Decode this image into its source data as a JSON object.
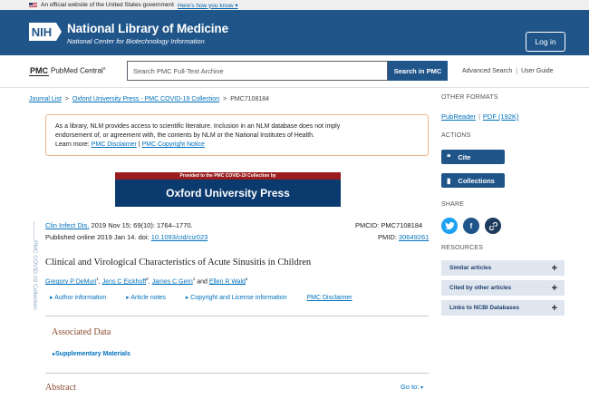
{
  "gov_banner": {
    "text": "An official website of the United States government",
    "link": "Here's how you know"
  },
  "header": {
    "logo": "NIH",
    "title": "National Library of Medicine",
    "subtitle": "National Center for Biotechnology Information",
    "login_label": "Log in"
  },
  "pmc": {
    "logo_mark": "PMC",
    "logo_name": "PubMed Central",
    "logo_sup": "®",
    "search_placeholder": "Search PMC Full-Text Archive",
    "search_button": "Search in PMC",
    "advanced_search": "Advanced Search",
    "user_guide": "User Guide"
  },
  "breadcrumb": {
    "items": [
      "Journal List",
      "Oxford University Press - PMC COVID-19 Collection",
      "PMC7108184"
    ]
  },
  "notice": {
    "line1": "As a library, NLM provides access to scientific literature. Inclusion in an NLM database does not imply",
    "line2": "endorsement of, or agreement with, the contents by NLM or the National Institutes of Health.",
    "learn_more": "Learn more:",
    "disclaimer": "PMC Disclaimer",
    "copyright": "PMC Copyright Notice"
  },
  "banner": {
    "top": "Provided to the PMC COVID-19 Collection by",
    "main": "Oxford University Press"
  },
  "article": {
    "side_label": "PMC COVID-19 Collection",
    "journal": "Clin Infect Dis.",
    "citation": " 2019 Nov 15; 69(10): 1764–1770.",
    "published": "Published online 2019 Jan 14. doi: ",
    "doi": "10.1093/cid/ciz023",
    "pmcid": "PMCID: PMC7108184",
    "pmid_label": "PMID: ",
    "pmid": "30649261",
    "title": "Clinical and Virological Characteristics of Acute Sinusitis in Children",
    "authors": [
      {
        "name": "Gregory P DeMuri",
        "sup": "1"
      },
      {
        "name": "Jens C Eickhoff",
        "sup": "2"
      },
      {
        "name": "James C Gern",
        "sup": "1"
      },
      {
        "name": "Ellen R Wald",
        "sup": "1"
      }
    ],
    "and": " and ",
    "links": [
      "Author information",
      "Article notes",
      "Copyright and License information"
    ],
    "disclaimer": "PMC Disclaimer",
    "associated_data": "Associated Data",
    "supplementary": "Supplementary Materials",
    "abstract": "Abstract",
    "goto": "Go to:"
  },
  "sidebar": {
    "other_formats": "OTHER FORMATS",
    "pubreader": "PubReader",
    "pdf": "PDF (192K)",
    "actions": "ACTIONS",
    "cite": "Cite",
    "collections": "Collections",
    "share": "SHARE",
    "resources": "RESOURCES",
    "resource_items": [
      "Similar articles",
      "Cited by other articles",
      "Links to NCBI Databases"
    ]
  },
  "colors": {
    "header": "#20558a",
    "link": "#0071bc",
    "section_title": "#8b4b2e",
    "twitter": "#1da1f2"
  }
}
